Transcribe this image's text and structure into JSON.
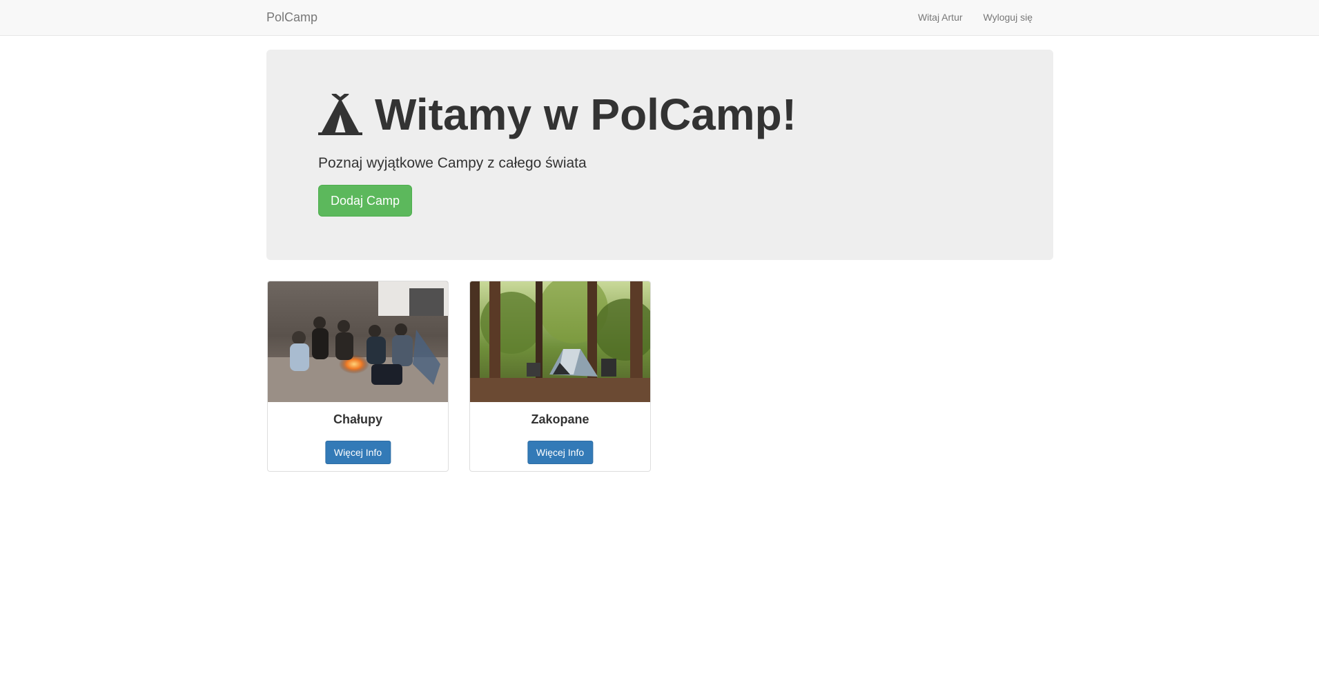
{
  "navbar": {
    "brand": "PolCamp",
    "links": [
      {
        "label": "Witaj Artur"
      },
      {
        "label": "Wyloguj się"
      }
    ]
  },
  "hero": {
    "icon": "tent-icon",
    "title": "Witamy w PolCamp!",
    "subtitle": "Poznaj wyjątkowe Campy z całego świata",
    "button_label": "Dodaj Camp",
    "button_color": "#5cb85c"
  },
  "campgrounds": [
    {
      "name": "Chałupy",
      "button_label": "Więcej Info",
      "image": "campfire-group-photo"
    },
    {
      "name": "Zakopane",
      "button_label": "Więcej Info",
      "image": "forest-tent-photo"
    }
  ],
  "colors": {
    "navbar_bg": "#f8f8f8",
    "jumbotron_bg": "#eeeeee",
    "primary": "#337ab7",
    "success": "#5cb85c"
  }
}
